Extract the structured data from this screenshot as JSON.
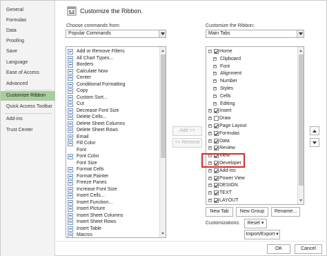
{
  "nav": {
    "items": [
      "General",
      "Formulas",
      "Data",
      "Proofing",
      "Save",
      "Language",
      "Ease of Access",
      "Advanced",
      "Customize Ribbon",
      "Quick Access Toolbar",
      "Add-ins",
      "Trust Center"
    ],
    "active_index": 8
  },
  "header": {
    "title": "Customize the Ribbon."
  },
  "left": {
    "choose_label": "Choose commands from:",
    "choose_value": "Popular Commands",
    "commands": [
      {
        "label": "Add or Remove Filters",
        "icon": "filter-icon"
      },
      {
        "label": "All Chart Types...",
        "icon": "chart-icon"
      },
      {
        "label": "Borders",
        "icon": "borders-icon",
        "submenu": true
      },
      {
        "label": "Calculate Now",
        "icon": "calculator-icon"
      },
      {
        "label": "Center",
        "icon": "center-align-icon"
      },
      {
        "label": "Conditional Formatting",
        "icon": "conditional-format-icon",
        "submenu": true
      },
      {
        "label": "Copy",
        "icon": "copy-icon"
      },
      {
        "label": "Custom Sort...",
        "icon": "sort-icon"
      },
      {
        "label": "Cut",
        "icon": "scissors-icon"
      },
      {
        "label": "Decrease Font Size",
        "icon": "decrease-font-icon"
      },
      {
        "label": "Delete Cells...",
        "icon": "delete-cells-icon"
      },
      {
        "label": "Delete Sheet Columns",
        "icon": "delete-columns-icon"
      },
      {
        "label": "Delete Sheet Rows",
        "icon": "delete-rows-icon"
      },
      {
        "label": "Email",
        "icon": "email-icon"
      },
      {
        "label": "Fill Color",
        "icon": "fill-color-icon",
        "submenu": true
      },
      {
        "label": "Font",
        "icon": "",
        "side_control": true
      },
      {
        "label": "Font Color",
        "icon": "font-color-icon",
        "side_control": true
      },
      {
        "label": "Font Size",
        "icon": "",
        "side_control": true
      },
      {
        "label": "Format Cells",
        "icon": "format-cells-icon"
      },
      {
        "label": "Format Painter",
        "icon": "format-painter-icon"
      },
      {
        "label": "Freeze Panes",
        "icon": "freeze-panes-icon",
        "submenu": true
      },
      {
        "label": "Increase Font Size",
        "icon": "increase-font-icon"
      },
      {
        "label": "Insert Cells...",
        "icon": "insert-cells-icon"
      },
      {
        "label": "Insert Function...",
        "icon": "function-icon"
      },
      {
        "label": "Insert Picture",
        "icon": "picture-icon"
      },
      {
        "label": "Insert Sheet Columns",
        "icon": "insert-columns-icon"
      },
      {
        "label": "Insert Sheet Rows",
        "icon": "insert-rows-icon"
      },
      {
        "label": "Insert Table",
        "icon": "table-icon"
      },
      {
        "label": "Macros",
        "icon": "macros-icon"
      }
    ]
  },
  "middle": {
    "add_label": "Add >>",
    "remove_label": "<< Remove"
  },
  "right": {
    "customize_label": "Customize the Ribbon:",
    "customize_value": "Main Tabs",
    "tree": [
      {
        "label": "Home",
        "level": 0,
        "expanded": true,
        "checked": true
      },
      {
        "label": "Clipboard",
        "level": 1
      },
      {
        "label": "Font",
        "level": 1
      },
      {
        "label": "Alignment",
        "level": 1
      },
      {
        "label": "Number",
        "level": 1
      },
      {
        "label": "Styles",
        "level": 1
      },
      {
        "label": "Cells",
        "level": 1
      },
      {
        "label": "Editing",
        "level": 1
      },
      {
        "label": "Insert",
        "level": 0,
        "checked": true
      },
      {
        "label": "Draw",
        "level": 0,
        "checked": false
      },
      {
        "label": "Page Layout",
        "level": 0,
        "checked": true
      },
      {
        "label": "Formulas",
        "level": 0,
        "checked": true
      },
      {
        "label": "Data",
        "level": 0,
        "checked": true
      },
      {
        "label": "Review",
        "level": 0,
        "checked": true
      },
      {
        "label": "View",
        "level": 0,
        "checked": true
      },
      {
        "label": "Developer",
        "level": 0,
        "checked": true
      },
      {
        "label": "Add-ins",
        "level": 0,
        "checked": true
      },
      {
        "label": "Power View",
        "level": 0,
        "checked": true
      },
      {
        "label": "DESIGN",
        "level": 0,
        "checked": true
      },
      {
        "label": "TEXT",
        "level": 0,
        "checked": true
      },
      {
        "label": "LAYOUT",
        "level": 0,
        "checked": true
      }
    ],
    "new_tab_label": "New Tab",
    "new_group_label": "New Group",
    "rename_label": "Rename...",
    "customizations_label": "Customizations:",
    "reset_label": "Reset ▾",
    "import_export_label": "Import/Export ▾"
  },
  "footer": {
    "ok_label": "OK",
    "cancel_label": "Cancel"
  },
  "colors": {
    "active_nav": "#a8cd9f",
    "highlight_box": "#e0261f"
  }
}
